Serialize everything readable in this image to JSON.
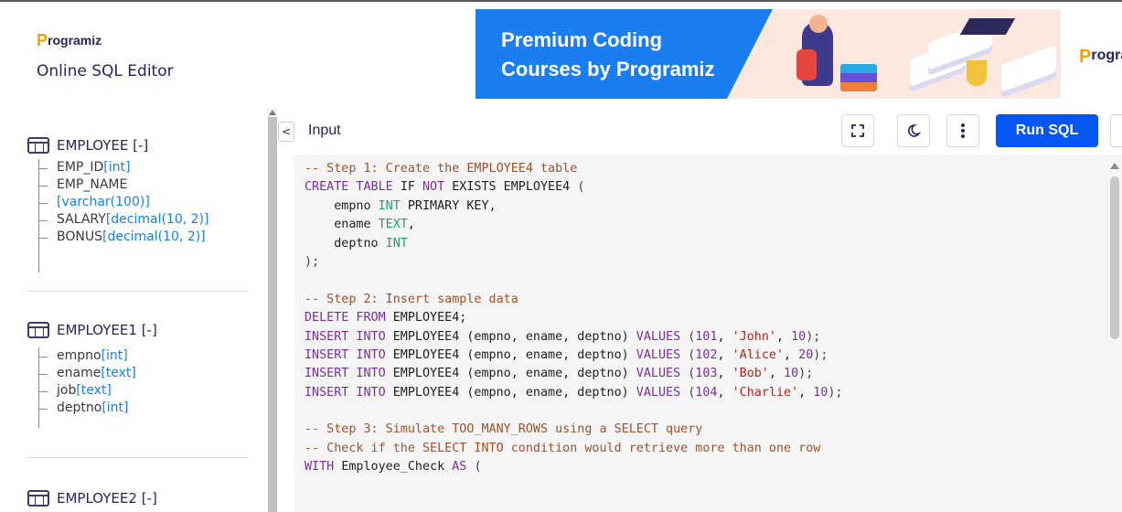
{
  "header": {
    "logo_text": "rogramiz",
    "logo_initial": "P",
    "editor_title": "Online SQL Editor"
  },
  "ad": {
    "line1": "Premium Coding",
    "line2": "Courses by Programiz",
    "brand_initial": "P",
    "brand_text": "rogramiz"
  },
  "sidebar": {
    "tables": [
      {
        "name": "EMPLOYEE [-]",
        "columns": [
          {
            "name": "EMP_ID",
            "type": "[int]"
          },
          {
            "name": "EMP_NAME",
            "type": ""
          },
          {
            "name": "",
            "type": "[varchar(100)]"
          },
          {
            "name": "SALARY",
            "type": "[decimal(10, 2)]"
          },
          {
            "name": "BONUS",
            "type": "[decimal(10, 2)]"
          }
        ]
      },
      {
        "name": "EMPLOYEE1 [-]",
        "columns": [
          {
            "name": "empno",
            "type": "[int]"
          },
          {
            "name": "ename",
            "type": "[text]"
          },
          {
            "name": "job",
            "type": "[text]"
          },
          {
            "name": "deptno",
            "type": "[int]"
          }
        ]
      },
      {
        "name": "EMPLOYEE2 [-]",
        "columns": []
      }
    ]
  },
  "editor": {
    "collapse_glyph": "<",
    "tab_label": "Input",
    "run_label": "Run SQL",
    "icons": [
      "fullscreen-icon",
      "dark-mode-icon",
      "more-options-icon"
    ]
  },
  "code": [
    [
      [
        "com",
        "-- Step 1: Create the EMPLOYEE4 table"
      ]
    ],
    [
      [
        "kw",
        "CREATE TABLE "
      ],
      [
        "txt",
        "IF "
      ],
      [
        "kw",
        "NOT "
      ],
      [
        "txt",
        "EXISTS EMPLOYEE4 "
      ],
      [
        "pun",
        "("
      ]
    ],
    [
      [
        "txt",
        "    empno "
      ],
      [
        "ty",
        "INT "
      ],
      [
        "txt",
        "PRIMARY KEY,"
      ]
    ],
    [
      [
        "txt",
        "    ename "
      ],
      [
        "ty",
        "TEXT"
      ],
      [
        "txt",
        ","
      ]
    ],
    [
      [
        "txt",
        "    deptno "
      ],
      [
        "ty",
        "INT"
      ]
    ],
    [
      [
        "pun",
        ");"
      ]
    ],
    [
      [
        "txt",
        ""
      ]
    ],
    [
      [
        "com",
        "-- Step 2: Insert sample data"
      ]
    ],
    [
      [
        "kw",
        "DELETE FROM "
      ],
      [
        "txt",
        "EMPLOYEE4;"
      ]
    ],
    [
      [
        "kw",
        "INSERT INTO "
      ],
      [
        "txt",
        "EMPLOYEE4 (empno, ename, deptno) "
      ],
      [
        "kw",
        "VALUES "
      ],
      [
        "pun",
        "("
      ],
      [
        "num",
        "101"
      ],
      [
        "txt",
        ", "
      ],
      [
        "str",
        "'John'"
      ],
      [
        "txt",
        ", "
      ],
      [
        "num",
        "10"
      ],
      [
        "pun",
        ");"
      ]
    ],
    [
      [
        "kw",
        "INSERT INTO "
      ],
      [
        "txt",
        "EMPLOYEE4 (empno, ename, deptno) "
      ],
      [
        "kw",
        "VALUES "
      ],
      [
        "pun",
        "("
      ],
      [
        "num",
        "102"
      ],
      [
        "txt",
        ", "
      ],
      [
        "str",
        "'Alice'"
      ],
      [
        "txt",
        ", "
      ],
      [
        "num",
        "20"
      ],
      [
        "pun",
        ");"
      ]
    ],
    [
      [
        "kw",
        "INSERT INTO "
      ],
      [
        "txt",
        "EMPLOYEE4 (empno, ename, deptno) "
      ],
      [
        "kw",
        "VALUES "
      ],
      [
        "pun",
        "("
      ],
      [
        "num",
        "103"
      ],
      [
        "txt",
        ", "
      ],
      [
        "str",
        "'Bob'"
      ],
      [
        "txt",
        ", "
      ],
      [
        "num",
        "10"
      ],
      [
        "pun",
        ");"
      ]
    ],
    [
      [
        "kw",
        "INSERT INTO "
      ],
      [
        "txt",
        "EMPLOYEE4 (empno, ename, deptno) "
      ],
      [
        "kw",
        "VALUES "
      ],
      [
        "pun",
        "("
      ],
      [
        "num",
        "104"
      ],
      [
        "txt",
        ", "
      ],
      [
        "str",
        "'Charlie'"
      ],
      [
        "txt",
        ", "
      ],
      [
        "num",
        "10"
      ],
      [
        "pun",
        ");"
      ]
    ],
    [
      [
        "txt",
        ""
      ]
    ],
    [
      [
        "com",
        "-- Step 3: Simulate TOO_MANY_ROWS using a SELECT query"
      ]
    ],
    [
      [
        "com",
        "-- Check if the SELECT INTO condition would retrieve more than one row"
      ]
    ],
    [
      [
        "kw",
        "WITH "
      ],
      [
        "txt",
        "Employee_Check "
      ],
      [
        "kw",
        "AS "
      ],
      [
        "pun",
        "("
      ]
    ]
  ]
}
